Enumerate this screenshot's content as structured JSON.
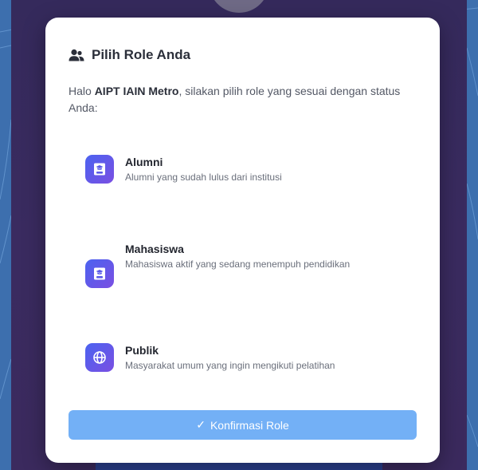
{
  "modal": {
    "title": "Pilih Role Anda",
    "header_icon": "users-icon",
    "intro_prefix": "Halo ",
    "intro_name": "AIPT IAIN Metro",
    "intro_suffix": ", silakan pilih role yang sesuai dengan status Anda:"
  },
  "roles": [
    {
      "name": "Alumni",
      "description": "Alumni yang sudah lulus dari institusi",
      "icon": "graduate-icon"
    },
    {
      "name": "Mahasiswa",
      "description": "Mahasiswa aktif yang sedang menempuh pendidikan",
      "icon": "graduate-icon"
    },
    {
      "name": "Publik",
      "description": "Masyarakat umum yang ingin mengikuti pelatihan",
      "icon": "globe-icon"
    }
  ],
  "confirm_button": {
    "label": "Konfirmasi Role",
    "icon": "check-icon"
  },
  "colors": {
    "accent_button": "#73b0f6",
    "role_icon_start": "#4b63f0",
    "role_icon_end": "#7a4fe2",
    "backdrop": "#3a2b60",
    "page_background": "#3d6fae"
  }
}
